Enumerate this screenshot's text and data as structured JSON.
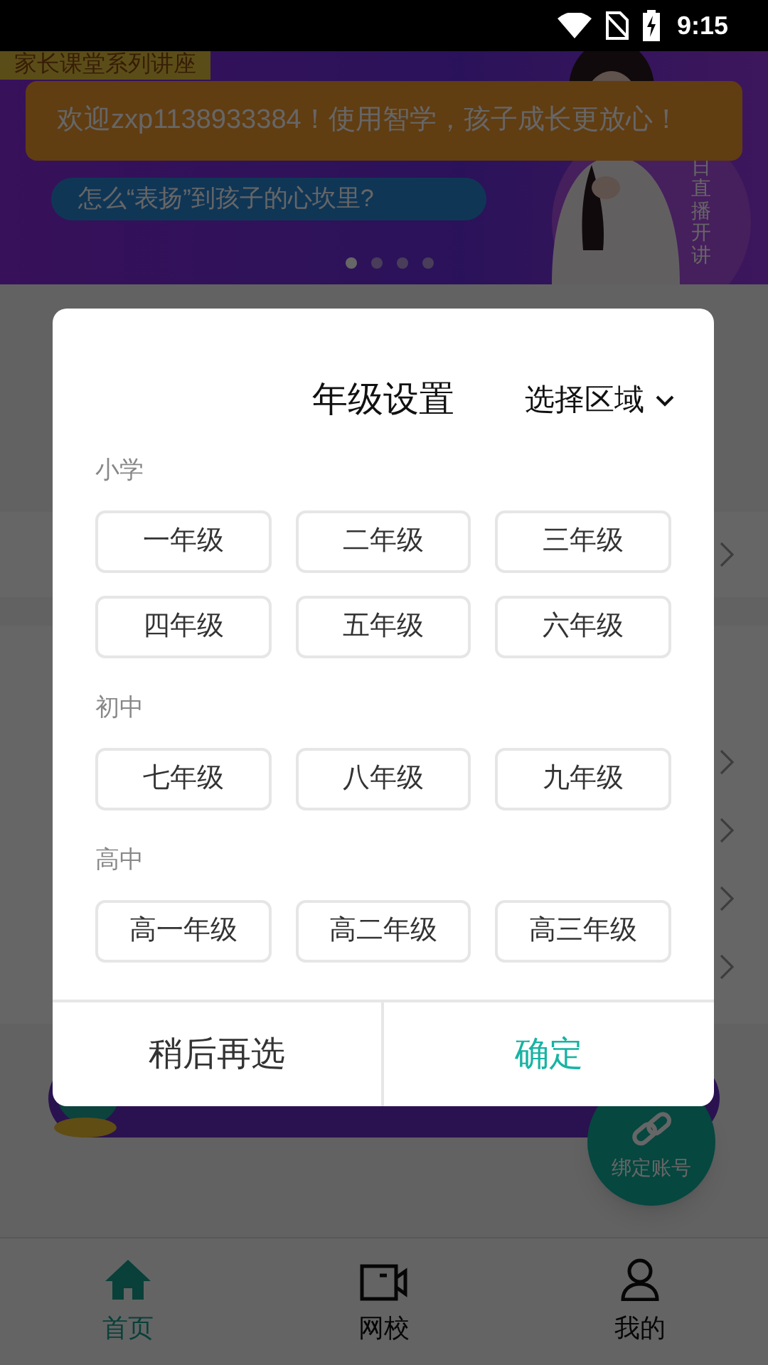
{
  "status_bar": {
    "time": "9:15"
  },
  "banner": {
    "tag": "家长课堂系列讲座",
    "subtitle": "怎么“表扬”到孩子的心坎里?",
    "side_text": "日直播开讲",
    "dots": [
      {
        "selected": true
      },
      {
        "selected": false
      },
      {
        "selected": false
      },
      {
        "selected": false
      }
    ]
  },
  "toast": "欢迎zxp1138933384！使用智学，孩子成长更放心！",
  "background_rows": [
    {
      "kind": "row"
    },
    {
      "kind": "heading"
    },
    {
      "kind": "row"
    },
    {
      "kind": "row"
    },
    {
      "kind": "row"
    },
    {
      "kind": "row"
    }
  ],
  "fab": {
    "label": "绑定账号"
  },
  "bottom_nav": [
    {
      "label": "首页",
      "selected": true
    },
    {
      "label": "网校",
      "selected": false
    },
    {
      "label": "我的",
      "selected": false
    }
  ],
  "dialog": {
    "title": "年级设置",
    "region_button": "选择区域",
    "groups": [
      {
        "name": "小学",
        "grades": [
          {
            "label": "一年级",
            "selected": false
          },
          {
            "label": "二年级",
            "selected": false
          },
          {
            "label": "三年级",
            "selected": false
          },
          {
            "label": "四年级",
            "selected": false
          },
          {
            "label": "五年级",
            "selected": false
          },
          {
            "label": "六年级",
            "selected": false
          }
        ]
      },
      {
        "name": "初中",
        "grades": [
          {
            "label": "七年级",
            "selected": false
          },
          {
            "label": "八年级",
            "selected": false
          },
          {
            "label": "九年级",
            "selected": false
          }
        ]
      },
      {
        "name": "高中",
        "grades": [
          {
            "label": "高一年级",
            "selected": false
          },
          {
            "label": "高二年级",
            "selected": false
          },
          {
            "label": "高三年级",
            "selected": false
          }
        ]
      }
    ],
    "cancel": "稍后再选",
    "confirm": "确定"
  }
}
